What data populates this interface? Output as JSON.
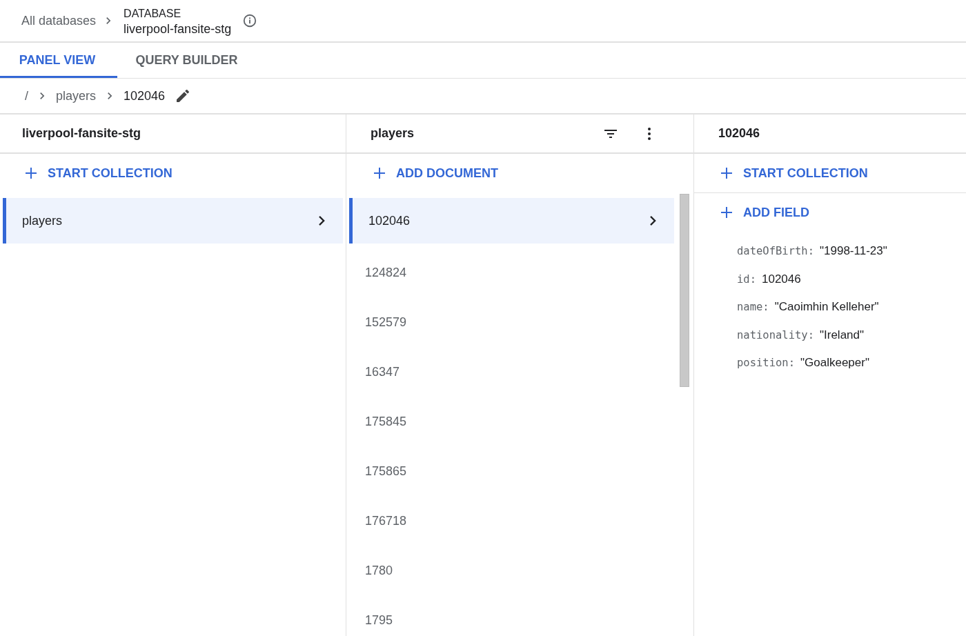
{
  "header": {
    "all_databases": "All databases",
    "database_label": "DATABASE",
    "database_name": "liverpool-fansite-stg"
  },
  "tabs": [
    {
      "label": "PANEL VIEW",
      "selected": true
    },
    {
      "label": "QUERY BUILDER",
      "selected": false
    }
  ],
  "path": {
    "root": "/",
    "segments": [
      "players",
      "102046"
    ]
  },
  "columns": [
    {
      "title": "liverpool-fansite-stg",
      "actions": [
        {
          "label": "START COLLECTION"
        }
      ],
      "items": [
        {
          "label": "players",
          "selected": true
        }
      ]
    },
    {
      "title": "players",
      "actions": [
        {
          "label": "ADD DOCUMENT"
        }
      ],
      "items": [
        {
          "label": "102046",
          "selected": true
        },
        {
          "label": "124824",
          "selected": false
        },
        {
          "label": "152579",
          "selected": false
        },
        {
          "label": "16347",
          "selected": false
        },
        {
          "label": "175845",
          "selected": false
        },
        {
          "label": "175865",
          "selected": false
        },
        {
          "label": "176718",
          "selected": false
        },
        {
          "label": "1780",
          "selected": false
        },
        {
          "label": "1795",
          "selected": false
        }
      ]
    },
    {
      "title": "102046",
      "actions": [
        {
          "label": "START COLLECTION"
        },
        {
          "label": "ADD FIELD"
        }
      ],
      "fields": [
        {
          "key": "dateOfBirth:",
          "value": "\"1998-11-23\""
        },
        {
          "key": "id:",
          "value": "102046"
        },
        {
          "key": "name:",
          "value": "\"Caoimhin Kelleher\""
        },
        {
          "key": "nationality:",
          "value": "\"Ireland\""
        },
        {
          "key": "position:",
          "value": "\"Goalkeeper\""
        }
      ]
    }
  ]
}
